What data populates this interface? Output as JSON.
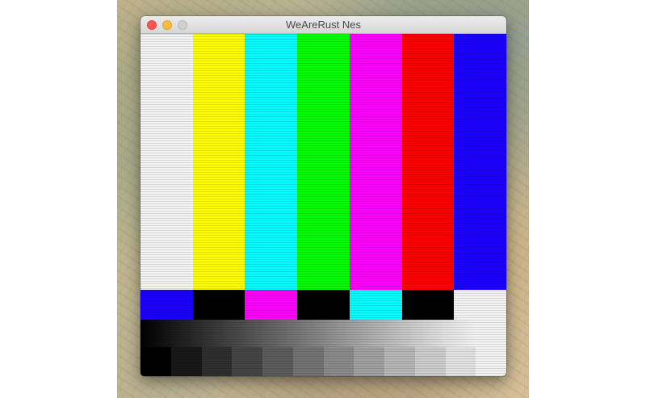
{
  "window": {
    "title": "WeAreRust Nes"
  },
  "test_pattern": {
    "top_bars": [
      {
        "name": "white",
        "color": "#f4f4f4"
      },
      {
        "name": "yellow",
        "color": "#ffff00"
      },
      {
        "name": "cyan",
        "color": "#00ffff"
      },
      {
        "name": "green",
        "color": "#00ff00"
      },
      {
        "name": "magenta",
        "color": "#ff00ff"
      },
      {
        "name": "red",
        "color": "#ff0000"
      },
      {
        "name": "blue",
        "color": "#1a00ff"
      }
    ],
    "middle_bars": [
      {
        "name": "blue",
        "color": "#1a00ff"
      },
      {
        "name": "black",
        "color": "#000000"
      },
      {
        "name": "magenta",
        "color": "#ff00ff"
      },
      {
        "name": "black",
        "color": "#000000"
      },
      {
        "name": "cyan",
        "color": "#00ffff"
      },
      {
        "name": "black",
        "color": "#000000"
      },
      {
        "name": "white",
        "color": "#f4f4f4"
      }
    ],
    "gray_steps": [
      "#000000",
      "#181818",
      "#2f2f2f",
      "#454545",
      "#5c5c5c",
      "#737373",
      "#8a8a8a",
      "#a1a1a1",
      "#b7b7b7",
      "#cdcdcd",
      "#e3e3e3",
      "#f4f4f4"
    ]
  }
}
